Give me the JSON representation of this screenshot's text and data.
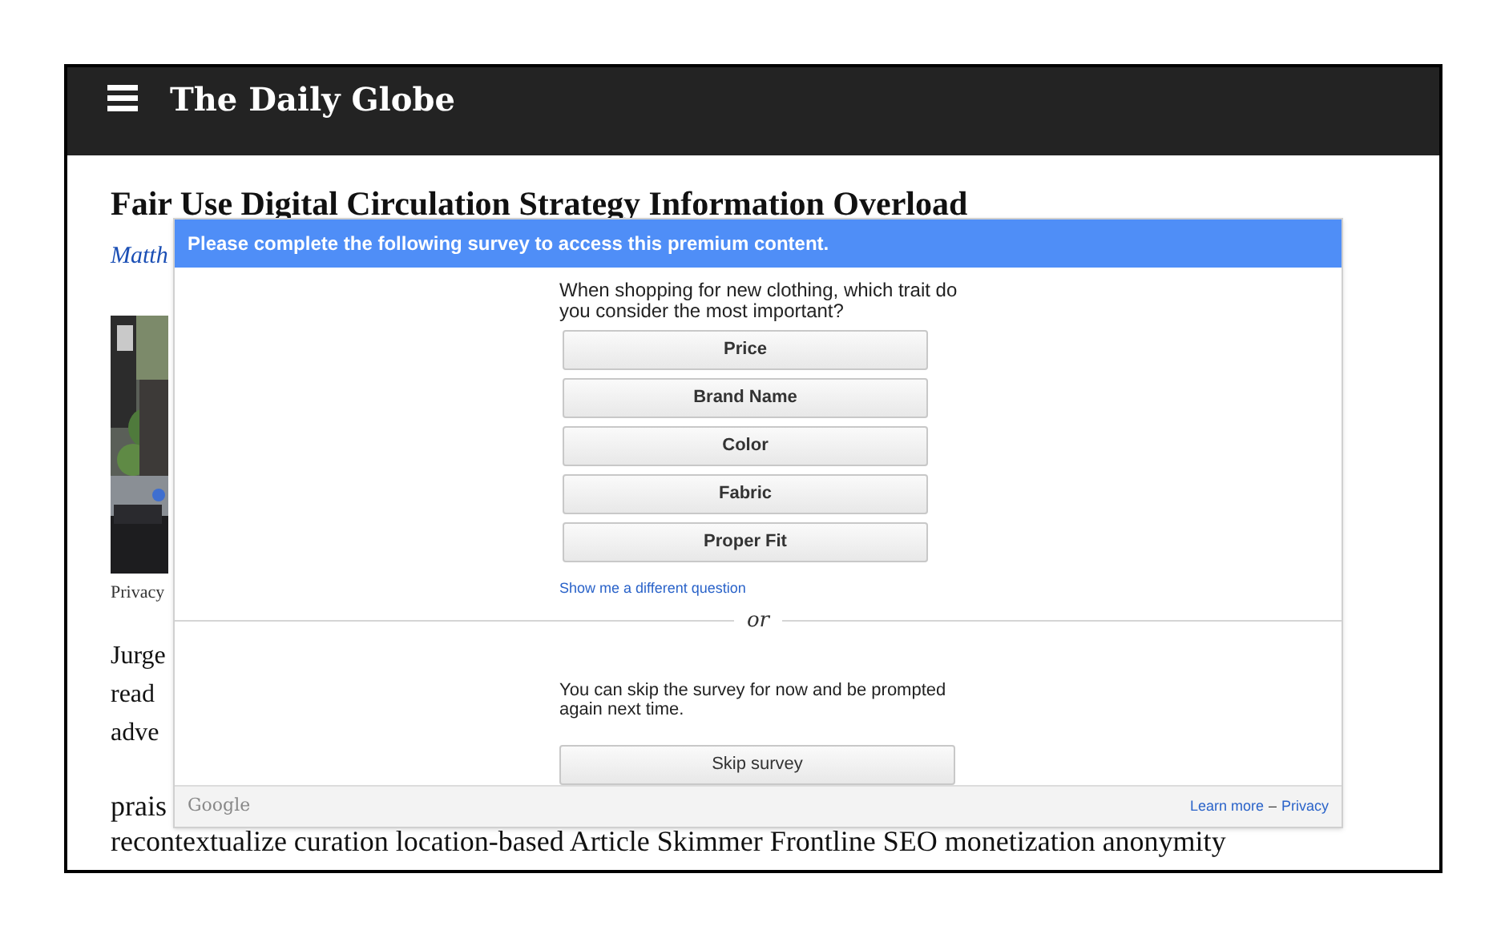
{
  "header": {
    "logo": "The Daily Globe"
  },
  "article": {
    "headline": "Fair Use Digital Circulation Strategy Information Overload",
    "byline": "Matth",
    "photo": {
      "kind": "picture"
    },
    "caption": "Privacy",
    "paragraph_1": [
      "Jurge",
      "read",
      "adve"
    ],
    "paragraph_2": [
      "prais",
      "recontextualize curation location-based Article Skimmer Frontline SEO monetization anonymity"
    ]
  },
  "survey": {
    "banner": "Please complete the following survey to access this premium content.",
    "question": "When shopping for new clothing, which trait do you consider the most important?",
    "answers": [
      "Price",
      "Brand Name",
      "Color",
      "Fabric",
      "Proper Fit"
    ],
    "link": "Show me a different question",
    "separator": "or",
    "skip_note": "You can skip the survey for now and be prompted again next time.",
    "skip_button": "Skip survey",
    "footer": {
      "brand": "Google",
      "learn_more": "Learn more",
      "dash": "–",
      "privacy": "Privacy"
    }
  }
}
